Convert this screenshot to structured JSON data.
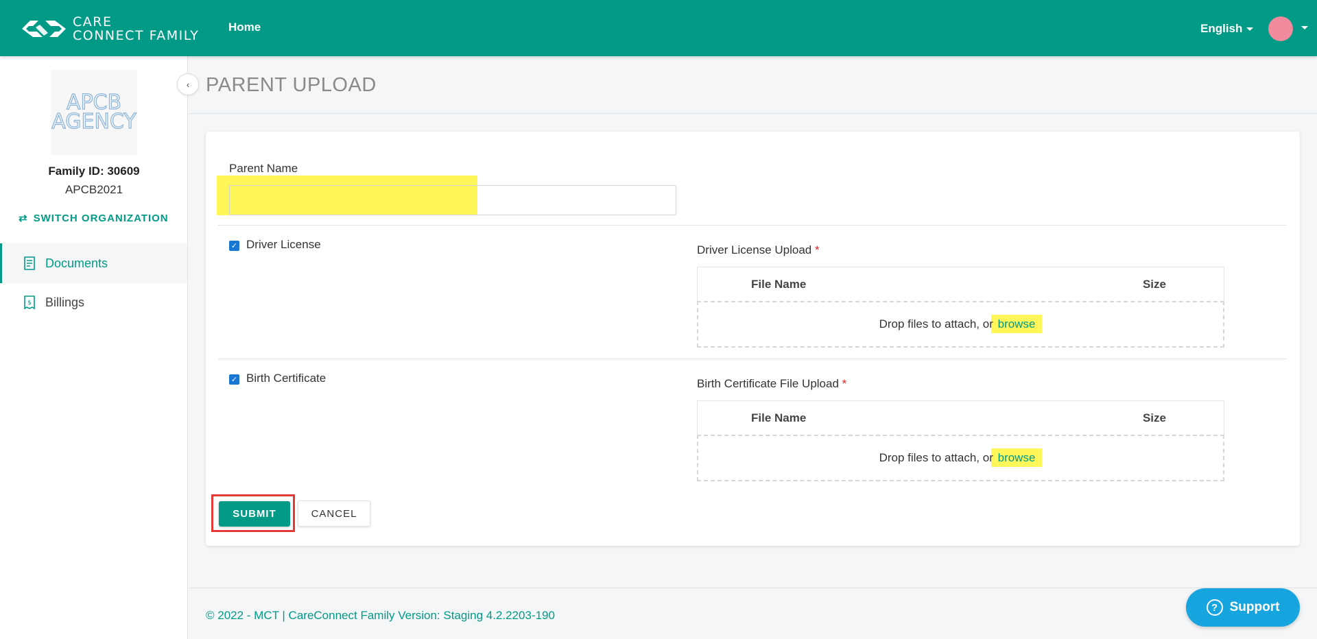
{
  "header": {
    "brand_line1": "CARE",
    "brand_line2": "CONNECT FAMILY",
    "nav_home": "Home",
    "language": "English"
  },
  "sidebar": {
    "agency_logo_line1": "APCB",
    "agency_logo_line2": "AGENCY",
    "family_id": "Family ID: 30609",
    "org_code": "APCB2021",
    "switch_org": "SWITCH ORGANIZATION",
    "items": [
      {
        "label": "Documents",
        "icon": "document-icon",
        "active": true
      },
      {
        "label": "Billings",
        "icon": "receipt-dollar-icon",
        "active": false
      }
    ]
  },
  "page": {
    "title": "PARENT UPLOAD"
  },
  "form": {
    "parent_name_label": "Parent Name",
    "parent_name_value": "",
    "sections": [
      {
        "checkbox_label": "Driver License",
        "checked": true,
        "upload_label": "Driver License Upload",
        "required_mark": "*",
        "col_file_name": "File Name",
        "col_size": "Size",
        "drop_text": "Drop files to attach, or",
        "browse_text": "browse"
      },
      {
        "checkbox_label": "Birth Certificate",
        "checked": true,
        "upload_label": "Birth Certificate File Upload",
        "required_mark": "*",
        "col_file_name": "File Name",
        "col_size": "Size",
        "drop_text": "Drop files to attach, or",
        "browse_text": "browse"
      }
    ],
    "submit_label": "SUBMIT",
    "cancel_label": "CANCEL"
  },
  "footer": {
    "text": "© 2022 - MCT | CareConnect Family Version: Staging 4.2.2203-190"
  },
  "support": {
    "label": "Support"
  },
  "colors": {
    "brand": "#019a87",
    "support": "#17a5e0",
    "highlight": "#fff53c",
    "submit_outline": "#e53935"
  }
}
